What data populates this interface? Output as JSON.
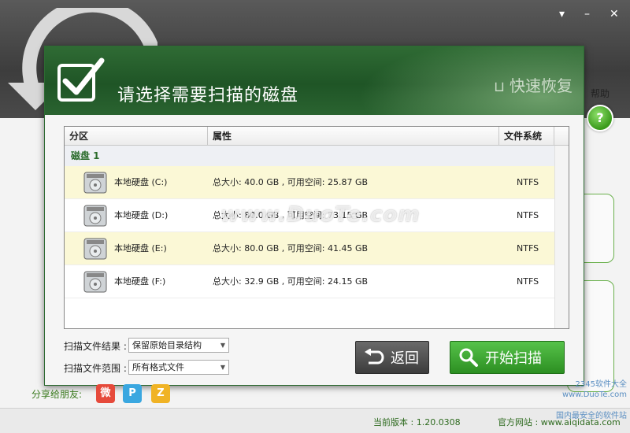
{
  "window": {
    "menu_icon": "▾",
    "minimize_icon": "–",
    "close_icon": "✕"
  },
  "help": {
    "label": "帮助",
    "icon": "?"
  },
  "dialog": {
    "title": "请选择需要扫描的磁盘",
    "brand": "快速恢复"
  },
  "table": {
    "columns": [
      "分区",
      "属性",
      "文件系统"
    ],
    "group": "磁盘 1",
    "rows": [
      {
        "name": "本地硬盘 (C:)",
        "attr": "总大小: 40.0 GB , 可用空间: 25.87 GB",
        "fs": "NTFS"
      },
      {
        "name": "本地硬盘 (D:)",
        "attr": "总大小: 80.0 GB , 可用空间: 73.15 GB",
        "fs": "NTFS"
      },
      {
        "name": "本地硬盘 (E:)",
        "attr": "总大小: 80.0 GB , 可用空间: 41.45 GB",
        "fs": "NTFS"
      },
      {
        "name": "本地硬盘 (F:)",
        "attr": "总大小: 32.9 GB , 可用空间: 24.15 GB",
        "fs": "NTFS"
      }
    ]
  },
  "options": {
    "result_label": "扫描文件结果 :",
    "result_value": "保留原始目录结构",
    "range_label": "扫描文件范围 :",
    "range_value": "所有格式文件"
  },
  "buttons": {
    "back": "返回",
    "start": "开始扫描"
  },
  "footer": {
    "share_label": "分享给朋友:",
    "version": "当前版本 : 1.20.0308",
    "site": "官方网站 : www.aiqidata.com"
  },
  "watermark": {
    "main": "www.DuoTe.com",
    "corner1": "2345软件大全",
    "corner2": "www.DuoTe.com",
    "corner3": "国内最安全的软件站"
  }
}
